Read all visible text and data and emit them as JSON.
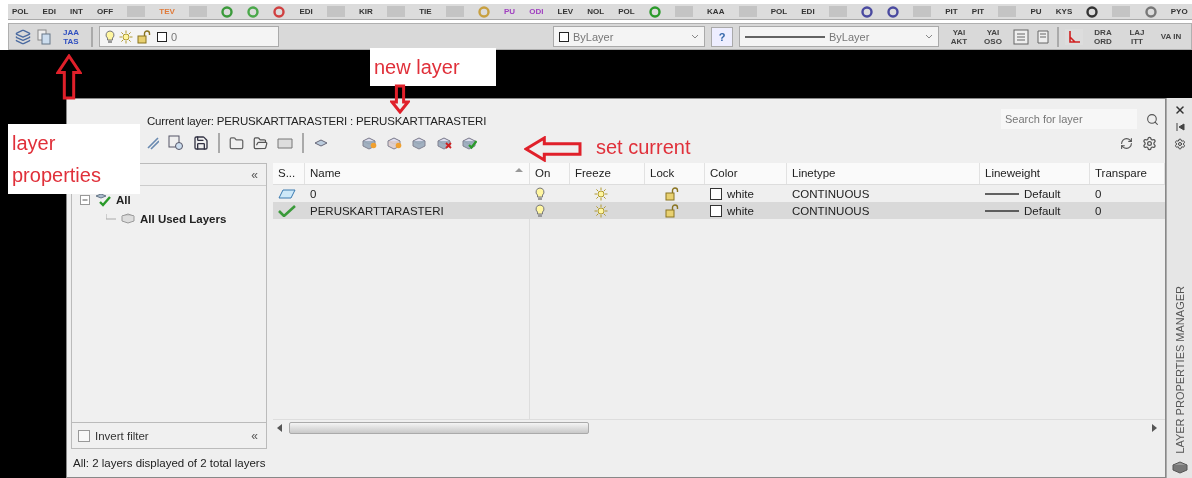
{
  "toolbar_top": {
    "items": [
      {
        "kind": "label",
        "text": "POL"
      },
      {
        "kind": "label",
        "text": "EDI"
      },
      {
        "kind": "label",
        "text": "INT"
      },
      {
        "kind": "label",
        "text": "OFF"
      },
      {
        "kind": "blank"
      },
      {
        "kind": "label",
        "text": "TEV",
        "color": "#e07a3a"
      },
      {
        "kind": "blank"
      },
      {
        "kind": "icon",
        "color": "#3a9a3a"
      },
      {
        "kind": "icon",
        "color": "#4aa84a"
      },
      {
        "kind": "icon",
        "color": "#d04040"
      },
      {
        "kind": "label",
        "text": "EDI"
      },
      {
        "kind": "blank"
      },
      {
        "kind": "label",
        "text": "KIR"
      },
      {
        "kind": "blank"
      },
      {
        "kind": "label",
        "text": "TIE"
      },
      {
        "kind": "blank"
      },
      {
        "kind": "icon",
        "color": "#c8a040"
      },
      {
        "kind": "label",
        "text": "PU",
        "color": "#a040c0"
      },
      {
        "kind": "label",
        "text": "ODI",
        "color": "#a040c0"
      },
      {
        "kind": "label",
        "text": "LEV"
      },
      {
        "kind": "label",
        "text": "NOL"
      },
      {
        "kind": "label",
        "text": "POL"
      },
      {
        "kind": "icon",
        "color": "#2a9a2a"
      },
      {
        "kind": "blank"
      },
      {
        "kind": "label",
        "text": "KAA"
      },
      {
        "kind": "blank"
      },
      {
        "kind": "label",
        "text": "POL"
      },
      {
        "kind": "label",
        "text": "EDI"
      },
      {
        "kind": "blank"
      },
      {
        "kind": "icon",
        "color": "#4a4aa0"
      },
      {
        "kind": "icon",
        "color": "#4a4aa0"
      },
      {
        "kind": "blank"
      },
      {
        "kind": "label",
        "text": "PIT"
      },
      {
        "kind": "label",
        "text": "PIT"
      },
      {
        "kind": "blank"
      },
      {
        "kind": "label",
        "text": "PU"
      },
      {
        "kind": "label",
        "text": "KYS"
      },
      {
        "kind": "icon",
        "color": "#333333"
      },
      {
        "kind": "blank"
      },
      {
        "kind": "icon",
        "color": "#777777"
      },
      {
        "kind": "label",
        "text": "PYO"
      }
    ]
  },
  "properties_toolbar": {
    "layer_button": "JAA TAS",
    "layer_value": "0",
    "color_value": "ByLayer",
    "help": "?",
    "linetype_value": "ByLayer",
    "buttons": [
      "YAI AKT",
      "YAI OSO"
    ],
    "more_buttons": [
      "DRA ORD",
      "LAJ ITT",
      "VA IN"
    ]
  },
  "annotations": [
    {
      "kind": "boxed",
      "text": "new layer"
    },
    {
      "kind": "boxed",
      "text": "layer properties"
    },
    {
      "kind": "plain",
      "text": "set current"
    }
  ],
  "panel": {
    "current_layer": "Current layer: PERUSKARTTARASTERI : PERUSKARTTARASTERI",
    "search": {
      "placeholder": "Search for layer"
    },
    "filters_collapse": "«",
    "tree": [
      {
        "label": "All",
        "expanded": true,
        "children": [
          {
            "label": "All Used Layers"
          }
        ]
      }
    ],
    "invert_filter": {
      "label": "Invert filter",
      "checked": false
    },
    "invert_collapse": "«",
    "columns": [
      "S...",
      "Name",
      "On",
      "Freeze",
      "Lock",
      "Color",
      "Linetype",
      "Lineweight",
      "Transpare"
    ],
    "rows": [
      {
        "current": false,
        "name": "0",
        "on": true,
        "frozen": false,
        "locked": false,
        "color_name": "white",
        "linetype": "CONTINUOUS",
        "lineweight": "Default",
        "transparency": "0",
        "selected": false
      },
      {
        "current": true,
        "name": "PERUSKARTTARASTERI",
        "on": true,
        "frozen": false,
        "locked": false,
        "color_name": "white",
        "linetype": "CONTINUOUS",
        "lineweight": "Default",
        "transparency": "0",
        "selected": true
      }
    ],
    "status": "All: 2 layers displayed of 2 total layers",
    "side_title": "LAYER PROPERTIES MANAGER"
  }
}
